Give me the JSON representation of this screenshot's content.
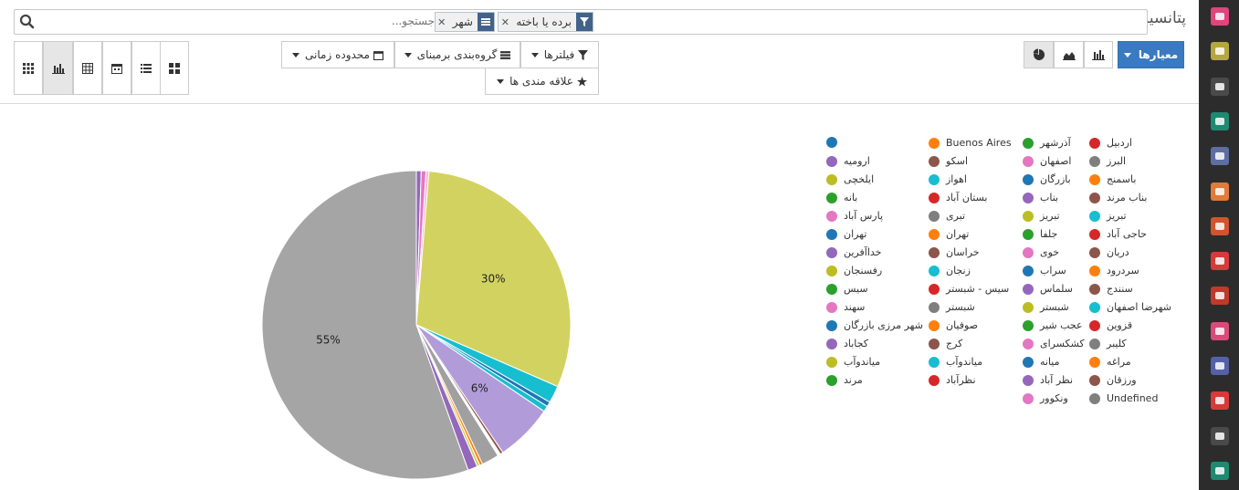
{
  "header": {
    "title": "پتانسیل",
    "search_placeholder": "جستجو...",
    "facets": [
      {
        "icon": "filter-icon",
        "value": "برده یا باخته",
        "color": "#41638a"
      },
      {
        "icon": "group-by-icon",
        "value": "شهر",
        "color": "#41638a"
      }
    ],
    "filters_label": "فیلترها",
    "groupby_label": "گروه‌بندی برمبنای",
    "timerange_label": "محدوده زمانی",
    "favorites_label": "علاقه مندی ها",
    "measures_label": "معیارها",
    "chart_type_buttons": [
      "bar-chart-icon",
      "area-chart-icon",
      "pie-chart-icon"
    ],
    "view_buttons": [
      "kanban-icon",
      "list-icon",
      "calendar-icon",
      "pivot-icon",
      "graph-icon",
      "grid-icon"
    ]
  },
  "sidebar": {
    "apps": [
      {
        "icon": "chat-icon",
        "color": "#e0457b"
      },
      {
        "icon": "calendar-icon",
        "color": "#b5a642"
      },
      {
        "icon": "notes-icon",
        "color": "#4a4a4a"
      },
      {
        "icon": "contacts-icon",
        "color": "#1f8a70"
      },
      {
        "icon": "handshake-icon",
        "color": "#5e6ea3"
      },
      {
        "icon": "trending-icon",
        "color": "#e07b3a"
      },
      {
        "icon": "globe-icon",
        "color": "#d0542c"
      },
      {
        "icon": "folder-icon",
        "color": "#d63a3a"
      },
      {
        "icon": "box-icon",
        "color": "#c0392b"
      },
      {
        "icon": "employees-icon",
        "color": "#d94a7a"
      },
      {
        "icon": "puzzle-icon",
        "color": "#5561a7"
      },
      {
        "icon": "timer-icon",
        "color": "#d83a3a"
      },
      {
        "icon": "send-icon",
        "color": "#4a4a4a"
      },
      {
        "icon": "tag-icon",
        "color": "#1f8a70"
      }
    ]
  },
  "chart_data": {
    "type": "pie",
    "title": "",
    "slices": [
      {
        "label": "ارومیه",
        "value": 0.5,
        "color": "#9467bd"
      },
      {
        "label": "اهواز",
        "value": 0.5,
        "color": "#e377c2"
      },
      {
        "label": "اسکو",
        "value": 0.3,
        "color": "#f7b6d2"
      },
      {
        "label": "تبریز",
        "value": 30,
        "color": "#d2d260"
      },
      {
        "label": "تبریز",
        "value": 1.8,
        "color": "#17becf"
      },
      {
        "label": "تهران",
        "value": 0.5,
        "color": "#1f77b4"
      },
      {
        "label": "تهران",
        "value": 0.6,
        "color": "#17becf"
      },
      {
        "label": "خداآفرین",
        "value": 6,
        "color": "#b19cd9"
      },
      {
        "label": "سراب",
        "value": 0.3,
        "color": "#8c564b"
      },
      {
        "label": "سلماس",
        "value": 0.3,
        "color": "#ffffff"
      },
      {
        "label": "شبستر",
        "value": 1.8,
        "color": "#a0a0a0"
      },
      {
        "label": "صوفیان",
        "value": 0.3,
        "color": "#ff7f0e"
      },
      {
        "label": "شبستر",
        "value": 0.3,
        "color": "#d2d260"
      },
      {
        "label": "کلیبر",
        "value": 1.0,
        "color": "#9467bd"
      },
      {
        "label": "Undefined",
        "value": 55,
        "color": "#a5a5a5"
      }
    ],
    "slice_labels": [
      "55%",
      "30%",
      "6%"
    ],
    "legend": [
      {
        "label": "اردبیل",
        "color": "#d62728"
      },
      {
        "label": "آذرشهر",
        "color": "#2ca02c"
      },
      {
        "label": "Buenos Aires",
        "color": "#ff7f0e"
      },
      {
        "label": "",
        "color": "#1f77b4"
      },
      {
        "label": "البرز",
        "color": "#7f7f7f"
      },
      {
        "label": "اصفهان",
        "color": "#e377c2"
      },
      {
        "label": "اسکو",
        "color": "#8c564b"
      },
      {
        "label": "ارومیه",
        "color": "#9467bd"
      },
      {
        "label": "باسمنج",
        "color": "#ff7f0e"
      },
      {
        "label": "بازرگان",
        "color": "#1f77b4"
      },
      {
        "label": "اهواز",
        "color": "#17becf"
      },
      {
        "label": "ایلخچی",
        "color": "#bcbd22"
      },
      {
        "label": "بناب مرند",
        "color": "#8c564b"
      },
      {
        "label": "بناب",
        "color": "#9467bd"
      },
      {
        "label": "بستان آباد",
        "color": "#d62728"
      },
      {
        "label": "بانه",
        "color": "#2ca02c"
      },
      {
        "label": "تبریز",
        "color": "#17becf"
      },
      {
        "label": "تبریز",
        "color": "#bcbd22"
      },
      {
        "label": "تبری",
        "color": "#7f7f7f"
      },
      {
        "label": "پارس آباد",
        "color": "#e377c2"
      },
      {
        "label": "حاجی آباد",
        "color": "#d62728"
      },
      {
        "label": "جلفا",
        "color": "#2ca02c"
      },
      {
        "label": "تهران",
        "color": "#ff7f0e"
      },
      {
        "label": "تهران",
        "color": "#1f77b4"
      },
      {
        "label": "دریان",
        "color": "#8c564b"
      },
      {
        "label": "خوی",
        "color": "#e377c2"
      },
      {
        "label": "خراسان",
        "color": "#8c564b"
      },
      {
        "label": "خداآفرین",
        "color": "#9467bd"
      },
      {
        "label": "سردرود",
        "color": "#ff7f0e"
      },
      {
        "label": "سراب",
        "color": "#1f77b4"
      },
      {
        "label": "زنجان",
        "color": "#17becf"
      },
      {
        "label": "رفسنجان",
        "color": "#bcbd22"
      },
      {
        "label": "سنندج",
        "color": "#8c564b"
      },
      {
        "label": "سلماس",
        "color": "#9467bd"
      },
      {
        "label": "سیس - شبستر",
        "color": "#d62728"
      },
      {
        "label": "سیس",
        "color": "#2ca02c"
      },
      {
        "label": "شهرضا اصفهان",
        "color": "#17becf"
      },
      {
        "label": "شبستر",
        "color": "#bcbd22"
      },
      {
        "label": "شبستر",
        "color": "#7f7f7f"
      },
      {
        "label": "سهند",
        "color": "#e377c2"
      },
      {
        "label": "قزوین",
        "color": "#d62728"
      },
      {
        "label": "عجب شیر",
        "color": "#2ca02c"
      },
      {
        "label": "صوفیان",
        "color": "#ff7f0e"
      },
      {
        "label": "شهر مرزی بازرگان",
        "color": "#1f77b4"
      },
      {
        "label": "کلیبر",
        "color": "#7f7f7f"
      },
      {
        "label": "کشکسرای",
        "color": "#e377c2"
      },
      {
        "label": "کرج",
        "color": "#8c564b"
      },
      {
        "label": "کجاباد",
        "color": "#9467bd"
      },
      {
        "label": "مراغه",
        "color": "#ff7f0e"
      },
      {
        "label": "میانه",
        "color": "#1f77b4"
      },
      {
        "label": "میاندوآب",
        "color": "#17becf"
      },
      {
        "label": "میاندوآب",
        "color": "#bcbd22"
      },
      {
        "label": "ورزقان",
        "color": "#8c564b"
      },
      {
        "label": "نظر آباد",
        "color": "#9467bd"
      },
      {
        "label": "نظرآباد",
        "color": "#d62728"
      },
      {
        "label": "مرند",
        "color": "#2ca02c"
      },
      {
        "label": "Undefined",
        "color": "#7f7f7f"
      },
      {
        "label": "ونکوور",
        "color": "#e377c2"
      }
    ]
  }
}
